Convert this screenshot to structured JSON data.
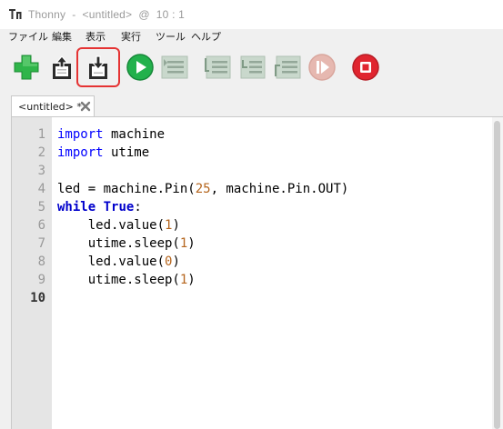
{
  "window": {
    "title": "Thonny  -  <untitled>  @  10 : 1"
  },
  "menu": {
    "items": [
      "ファイル",
      "編集",
      "表示",
      "実行",
      "ツール",
      "ヘルプ"
    ]
  },
  "toolbar": {
    "buttons": [
      {
        "icon": "new-file-icon"
      },
      {
        "icon": "open-file-icon"
      },
      {
        "icon": "save-file-icon",
        "highlighted": true
      },
      {
        "icon": "run-icon"
      },
      {
        "icon": "debug-icon"
      },
      {
        "icon": "step-over-icon"
      },
      {
        "icon": "step-into-icon"
      },
      {
        "icon": "step-out-icon"
      },
      {
        "icon": "resume-icon"
      },
      {
        "icon": "stop-icon"
      }
    ],
    "highlight_color": "#e53333"
  },
  "editor": {
    "tab": {
      "label": "<untitled> *",
      "close_icon": "close-icon"
    },
    "line_numbers": [
      "1",
      "2",
      "3",
      "4",
      "5",
      "6",
      "7",
      "8",
      "9",
      "10"
    ],
    "current_line": "10",
    "lines": [
      [
        {
          "t": "import",
          "c": "kw"
        },
        {
          "t": " machine",
          "c": ""
        }
      ],
      [
        {
          "t": "import",
          "c": "kw"
        },
        {
          "t": " utime",
          "c": ""
        }
      ],
      [],
      [
        {
          "t": "led = machine.Pin(",
          "c": ""
        },
        {
          "t": "25",
          "c": "num"
        },
        {
          "t": ", machine.Pin.OUT)",
          "c": ""
        }
      ],
      [
        {
          "t": "while",
          "c": "kw-b"
        },
        {
          "t": " ",
          "c": ""
        },
        {
          "t": "True",
          "c": "kw-b"
        },
        {
          "t": ":",
          "c": ""
        }
      ],
      [
        {
          "t": "    led.value(",
          "c": ""
        },
        {
          "t": "1",
          "c": "num"
        },
        {
          "t": ")",
          "c": ""
        }
      ],
      [
        {
          "t": "    utime.sleep(",
          "c": ""
        },
        {
          "t": "1",
          "c": "num"
        },
        {
          "t": ")",
          "c": ""
        }
      ],
      [
        {
          "t": "    led.value(",
          "c": ""
        },
        {
          "t": "0",
          "c": "num"
        },
        {
          "t": ")",
          "c": ""
        }
      ],
      [
        {
          "t": "    utime.sleep(",
          "c": ""
        },
        {
          "t": "1",
          "c": "num"
        },
        {
          "t": ")",
          "c": ""
        }
      ],
      []
    ]
  },
  "colors": {
    "keyword": "#0000ff",
    "number": "#b5651d",
    "gutter": "#e5e5e5",
    "run_green": "#22b14c",
    "stop_red": "#e0252f"
  }
}
